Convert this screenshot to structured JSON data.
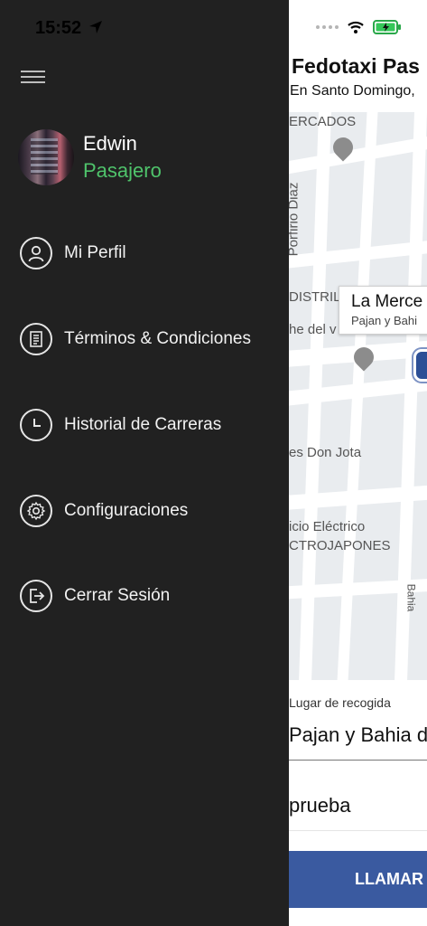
{
  "status_bar": {
    "time": "15:52"
  },
  "drawer": {
    "user": {
      "name": "Edwin",
      "role": "Pasajero"
    },
    "menu": [
      {
        "label": "Mi Perfil",
        "icon": "user-icon"
      },
      {
        "label": "Términos & Condiciones",
        "icon": "document-icon"
      },
      {
        "label": "Historial de Carreras",
        "icon": "clock-icon"
      },
      {
        "label": "Configuraciones",
        "icon": "gear-icon"
      },
      {
        "label": "Cerrar Sesión",
        "icon": "logout-icon"
      }
    ]
  },
  "app": {
    "title": "Fedotaxi Pas",
    "subtitle": "En Santo Domingo,"
  },
  "map": {
    "labels": [
      "ERCADOS",
      "Porfirio Diaz",
      "DISTRIL",
      "he del v",
      "es Don Jota",
      "icio Eléctrico",
      "CTROJAPONES",
      "Bahia"
    ],
    "callout": {
      "title": "La Merce",
      "subtitle": "Pajan y Bahi"
    }
  },
  "form": {
    "pickup_label": "Lugar de recogida",
    "pickup_value": "Pajan y Bahia d",
    "note_value": "prueba",
    "call_button": "LLAMAR"
  },
  "colors": {
    "drawer_bg": "#212121",
    "role": "#4fc36b",
    "button": "#3a5aa0"
  }
}
